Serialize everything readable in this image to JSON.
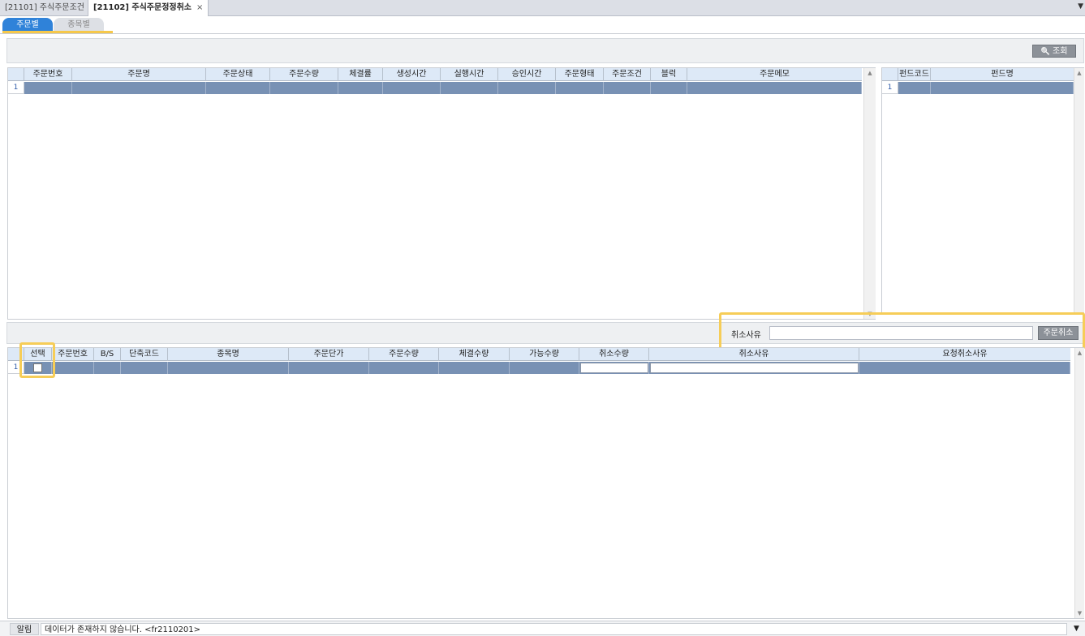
{
  "doc_tabs": [
    {
      "label": "[21101] 주식주문조건"
    },
    {
      "label": "[21102] 주식주문정정취소",
      "close": "×"
    }
  ],
  "tabs_menu": "▼",
  "sub_tabs": {
    "order": "주문별",
    "item": "종목별"
  },
  "search_button": {
    "icon": "🔍",
    "label": "조회"
  },
  "order_grid": {
    "columns": [
      "주문번호",
      "주문명",
      "주문상태",
      "주문수량",
      "체결률",
      "생성시간",
      "실행시간",
      "승인시간",
      "주문형태",
      "주문조건",
      "블럭",
      "주문메모"
    ],
    "row_number": "1"
  },
  "fund_grid": {
    "columns": [
      "펀드코드",
      "펀드명"
    ],
    "row_number": "1"
  },
  "cancel_panel": {
    "reason_label": "취소사유",
    "reason_value": "",
    "cancel_button": "주문취소"
  },
  "detail_grid": {
    "columns": [
      "선택",
      "주문번호",
      "B/S",
      "단축코드",
      "종목명",
      "주문단가",
      "주문수량",
      "체결수량",
      "가능수량",
      "취소수량",
      "취소사유",
      "요청취소사유"
    ],
    "row_number": "1"
  },
  "status_bar": {
    "label": "알림",
    "message": "데이터가 존재하지 않습니다. <fr2110201>",
    "dropdown": "▼"
  },
  "colors": {
    "accent": "#2f82d9",
    "highlight": "#f6c84a",
    "selected_row": "#7891b4",
    "header_bg": "#dde9f7"
  }
}
